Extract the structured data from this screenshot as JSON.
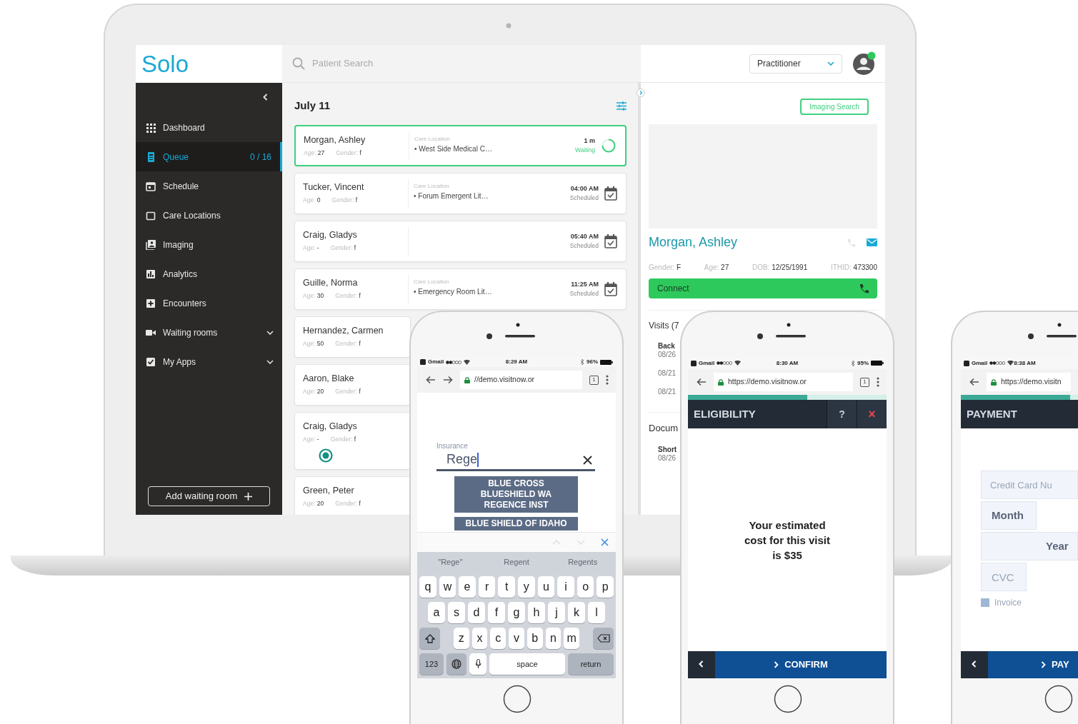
{
  "laptop": {
    "logo": "Solo",
    "search": {
      "placeholder": "Patient Search"
    },
    "role_select": {
      "value": "Practitioner"
    },
    "sidebar": {
      "items": [
        {
          "label": "Dashboard",
          "selected": false,
          "has_submenu": false
        },
        {
          "label": "Queue",
          "count": "0 / 16",
          "selected": true,
          "has_submenu": false
        },
        {
          "label": "Schedule",
          "selected": false,
          "has_submenu": false
        },
        {
          "label": "Care Locations",
          "selected": false,
          "has_submenu": false
        },
        {
          "label": "Imaging",
          "selected": false,
          "has_submenu": false
        },
        {
          "label": "Analytics",
          "selected": false,
          "has_submenu": false
        },
        {
          "label": "Encounters",
          "selected": false,
          "has_submenu": false
        },
        {
          "label": "Waiting rooms",
          "selected": false,
          "has_submenu": true
        },
        {
          "label": "My Apps",
          "selected": false,
          "has_submenu": true
        }
      ],
      "add_button": "Add waiting room"
    },
    "queue": {
      "date": "July 11",
      "patients": [
        {
          "name": "Morgan, Ashley",
          "age_label": "Age:",
          "age": "27",
          "gender_label": "Gender:",
          "gender": "f",
          "location_label": "Care Location",
          "location": "• West Side Medical C…",
          "time": "1 m",
          "status": "Waiting",
          "kind": "waiting",
          "selected": true
        },
        {
          "name": "Tucker, Vincent",
          "age_label": "Age:",
          "age": "0",
          "gender_label": "Gender:",
          "gender": "f",
          "location_label": "Care Location",
          "location": "• Forum Emergent Lit…",
          "time": "04:00 AM",
          "status": "Scheduled",
          "kind": "scheduled",
          "selected": false
        },
        {
          "name": "Craig, Gladys",
          "age_label": "Age:",
          "age": "-",
          "gender_label": "Gender:",
          "gender": "f",
          "time": "05:40 AM",
          "status": "Scheduled",
          "kind": "scheduled",
          "selected": false
        },
        {
          "name": "Guille, Norma",
          "age_label": "Age:",
          "age": "30",
          "gender_label": "Gender:",
          "gender": "f",
          "location_label": "Care Location",
          "location": "• Emergency Room Lit…",
          "time": "11:25 AM",
          "status": "Scheduled",
          "kind": "scheduled",
          "selected": false
        },
        {
          "name": "Hernandez, Carmen",
          "age_label": "Age:",
          "age": "50",
          "gender_label": "Gender:",
          "gender": "f",
          "selected": false
        },
        {
          "name": "Aaron, Blake",
          "age_label": "Age:",
          "age": "20",
          "gender_label": "Gender:",
          "gender": "f",
          "selected": false
        },
        {
          "name": "Craig, Gladys",
          "age_label": "Age:",
          "age": "-",
          "gender_label": "Gender:",
          "gender": "f",
          "selected": false,
          "radio_selected": true
        },
        {
          "name": "Green, Peter",
          "age_label": "Age:",
          "age": "20",
          "gender_label": "Gender:",
          "gender": "f",
          "selected": false
        }
      ]
    },
    "detail": {
      "imaging_search": "Imaging Search",
      "name": "Morgan, Ashley",
      "fields": [
        {
          "label": "Gender:",
          "value": "F"
        },
        {
          "label": "Age:",
          "value": "27"
        },
        {
          "label": "DOB:",
          "value": "12/25/1991"
        },
        {
          "label": "ITHID:",
          "value": "473300"
        }
      ],
      "connect": "Connect",
      "visits_title": "Visits (7",
      "visits": [
        {
          "title": "Back",
          "date": "08/26"
        },
        {
          "date": "08/21"
        },
        {
          "date": "08/21"
        }
      ],
      "documents_title": "Docum",
      "documents": [
        {
          "title": "Short",
          "date": "08/26"
        }
      ]
    }
  },
  "phones": [
    {
      "kind": "insurance",
      "carrier": "Gmail",
      "time": "8:29 AM",
      "battery": "96%",
      "forward": true,
      "url": "//demo.visitnow.or",
      "tab_count": "1",
      "label": "Insurance",
      "value": "Rege",
      "suggestions": [
        "BLUE CROSS\nBLUESHIELD WA\nREGENCE INST",
        "BLUE SHIELD OF IDAHO"
      ],
      "predictions": [
        "\"Rege\"",
        "Regent",
        "Regents"
      ],
      "keyboard": {
        "rows": [
          [
            "q",
            "w",
            "e",
            "r",
            "t",
            "y",
            "u",
            "i",
            "o",
            "p"
          ],
          [
            "a",
            "s",
            "d",
            "f",
            "g",
            "h",
            "j",
            "k",
            "l"
          ],
          [
            "z",
            "x",
            "c",
            "v",
            "b",
            "n",
            "m"
          ]
        ],
        "numbers": "123",
        "space": "space",
        "return": "return"
      }
    },
    {
      "kind": "eligibility",
      "carrier": "Gmail",
      "time": "8:30 AM",
      "battery": "95%",
      "forward": false,
      "url": "https://demo.visitnow.or",
      "tab_count": "1",
      "progress": {
        "level": 0.6
      },
      "title": "ELIGIBILITY",
      "help": "?",
      "close": "×",
      "message": "Your estimated\ncost for this visit\nis $35",
      "action": "CONFIRM"
    },
    {
      "kind": "payment",
      "carrier": "Gmail",
      "time": "8:38 AM",
      "forward": false,
      "url": "https://demo.visitn",
      "progress": {
        "level": 0.93
      },
      "title": "PAYMENT",
      "fields": [
        {
          "kind": "input",
          "placeholder": "Credit Card Nu"
        },
        {
          "kind": "select",
          "value": "Month"
        },
        {
          "kind": "select",
          "value": "Year"
        },
        {
          "kind": "input",
          "placeholder": "CVC"
        }
      ],
      "invoice": {
        "label": "Invoice",
        "checked": false
      },
      "action": "PAY"
    }
  ]
}
